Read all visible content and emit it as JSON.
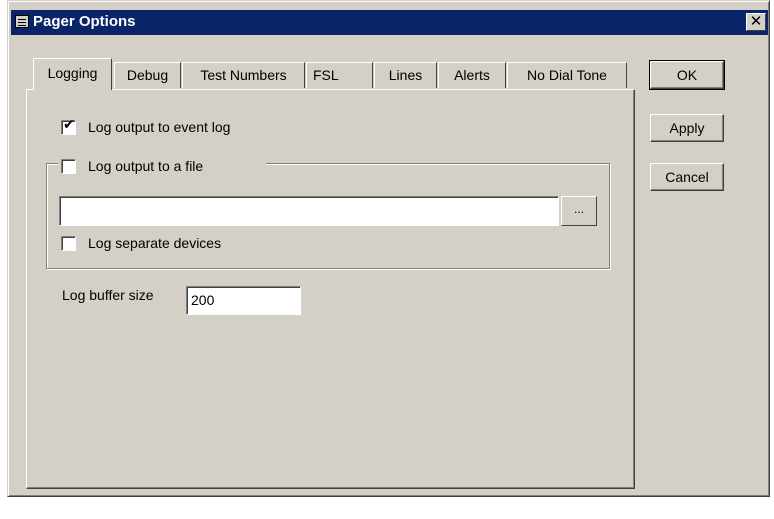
{
  "window": {
    "title": "Pager Options",
    "close_glyph": "✕"
  },
  "tabs": [
    {
      "label": "Logging",
      "active": true
    },
    {
      "label": "Debug",
      "active": false
    },
    {
      "label": "Test Numbers",
      "active": false
    },
    {
      "label": "FSL",
      "active": false
    },
    {
      "label": "Lines",
      "active": false
    },
    {
      "label": "Alerts",
      "active": false
    },
    {
      "label": "No Dial Tone",
      "active": false
    }
  ],
  "buttons": {
    "ok": "OK",
    "apply": "Apply",
    "cancel": "Cancel",
    "browse": "..."
  },
  "logging": {
    "event_log": {
      "label": "Log output to event log",
      "checked": true
    },
    "file_group": {
      "label": "Log output to a file",
      "checked": false
    },
    "file_path": {
      "value": ""
    },
    "separate_devices": {
      "label": "Log separate devices",
      "checked": false
    },
    "buffer_size": {
      "label": "Log buffer size",
      "value": "200"
    }
  },
  "colors": {
    "titlebar": "#0a246a",
    "face": "#d4d0c8"
  },
  "icons": {
    "window_icon": "pager-icon",
    "check": "checkmark-icon"
  }
}
